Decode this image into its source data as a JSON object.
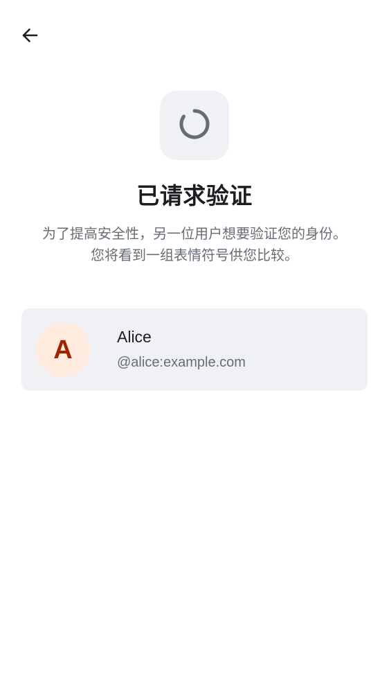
{
  "header": {
    "back_icon": "arrow-left-icon"
  },
  "status": {
    "icon": "loading-spinner-icon"
  },
  "title": "已请求验证",
  "description": {
    "line1": "为了提高安全性，另一位用户想要验证您的身份。",
    "line2": "您将看到一组表情符号供您比较。"
  },
  "user": {
    "avatar_initial": "A",
    "name": "Alice",
    "id": "@alice:example.com"
  },
  "colors": {
    "avatar_bg": "#ffebe0",
    "avatar_text": "#a32200",
    "card_bg": "#f0f1f4",
    "text_primary": "#1b1d22",
    "text_secondary": "#656d77"
  }
}
